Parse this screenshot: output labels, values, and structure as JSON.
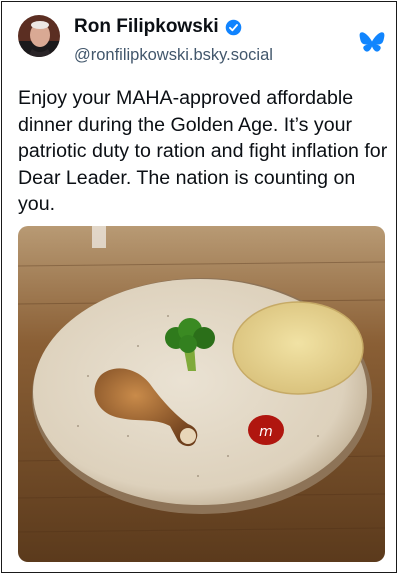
{
  "post": {
    "author": {
      "display_name": "Ron Filipkowski",
      "handle": "@ronfilipkowski.bsky.social",
      "verified": true
    },
    "text": "Enjoy your MAHA-approved affordable dinner during the Golden Age. It’s your patriotic duty to ration and fight inflation for Dear Leader. The nation is counting on you.",
    "image": {
      "items": [
        "chicken drumstick",
        "broccoli floret",
        "tortilla chip",
        "m&m candy"
      ],
      "candy_letter": "m"
    }
  },
  "icons": {
    "verified": "verified-check-icon",
    "platform": "butterfly-icon"
  },
  "colors": {
    "text": "#0b0f14",
    "handle": "#42576c",
    "verified": "#1083fe",
    "platform": "#1185fe",
    "plate": "#e0d5c2",
    "table": "#6a4320"
  }
}
